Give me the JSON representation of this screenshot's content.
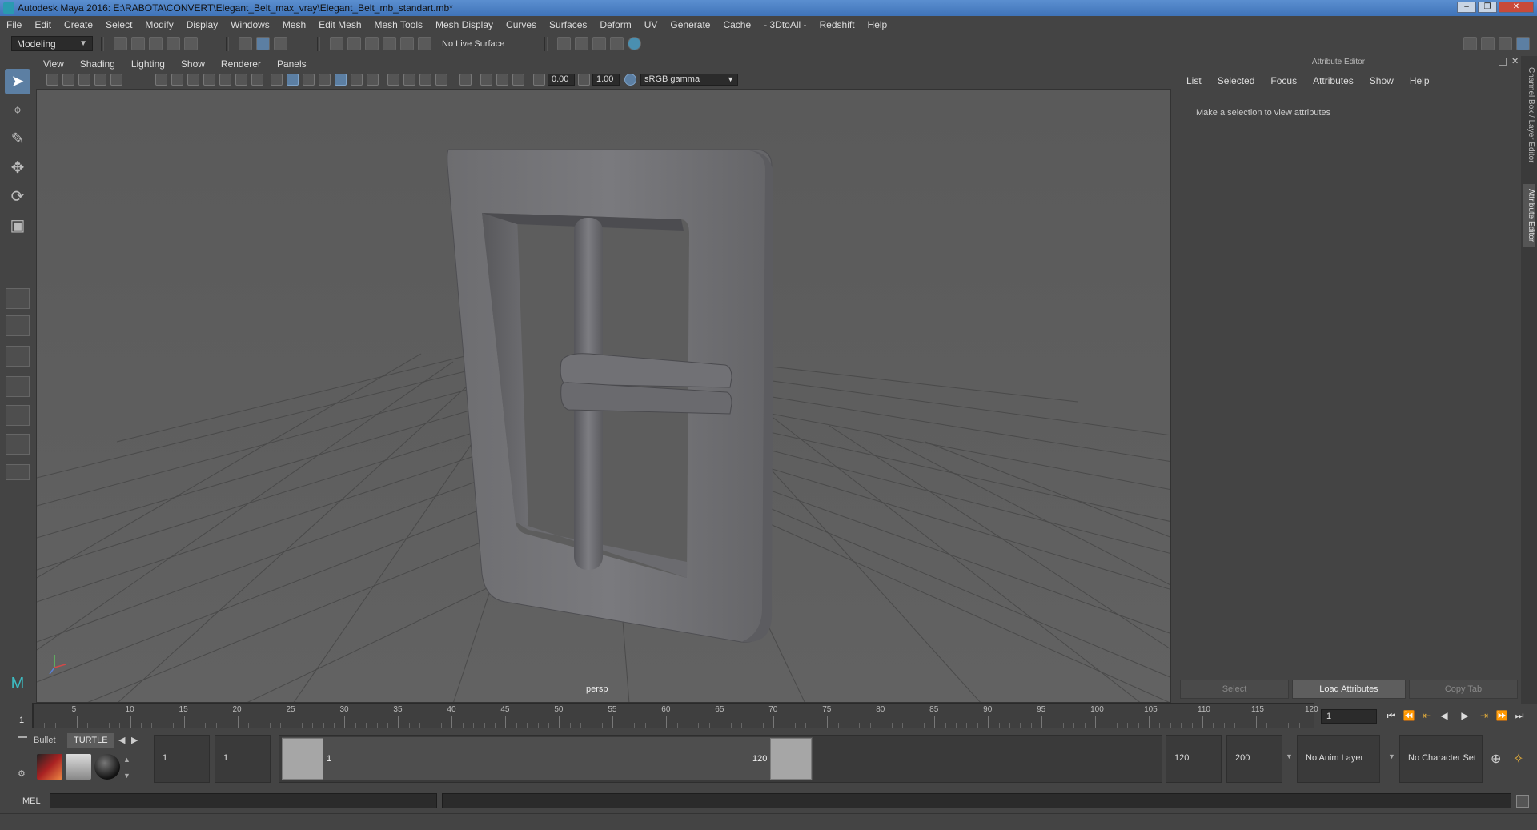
{
  "window": {
    "title": "Autodesk Maya 2016: E:\\RABOTA\\CONVERT\\Elegant_Belt_max_vray\\Elegant_Belt_mb_standart.mb*",
    "controls": [
      "–",
      "❐",
      "✕"
    ]
  },
  "menubar": [
    "File",
    "Edit",
    "Create",
    "Select",
    "Modify",
    "Display",
    "Windows",
    "Mesh",
    "Edit Mesh",
    "Mesh Tools",
    "Mesh Display",
    "Curves",
    "Surfaces",
    "Deform",
    "UV",
    "Generate",
    "Cache",
    "- 3DtoAll -",
    "Redshift",
    "Help"
  ],
  "toolbar": {
    "mode": "Modeling",
    "live_surface": "No Live Surface"
  },
  "viewport": {
    "menu": [
      "View",
      "Shading",
      "Lighting",
      "Show",
      "Renderer",
      "Panels"
    ],
    "exposure": "0.00",
    "gamma": "1.00",
    "color_space": "sRGB gamma",
    "camera_label": "persp"
  },
  "attribute_editor": {
    "title": "Attribute Editor",
    "menu": [
      "List",
      "Selected",
      "Focus",
      "Attributes",
      "Show",
      "Help"
    ],
    "message": "Make a selection to view attributes",
    "buttons": [
      "Select",
      "Load Attributes",
      "Copy Tab"
    ],
    "side_tabs": [
      "Channel Box / Layer Editor",
      "Attribute Editor"
    ]
  },
  "timeslider": {
    "current_frame": "1",
    "ticks": [
      "5",
      "10",
      "15",
      "20",
      "25",
      "30",
      "35",
      "40",
      "45",
      "50",
      "55",
      "60",
      "65",
      "70",
      "75",
      "80",
      "85",
      "90",
      "95",
      "100",
      "105",
      "110",
      "115",
      "120"
    ],
    "frame_field": "1"
  },
  "rangeslider": {
    "shelf_tabs": [
      "Bullet",
      "TURTLE"
    ],
    "start_field": "1",
    "range_start_field": "1",
    "range_start_label": "1",
    "range_end_label": "120",
    "range_end_field": "120",
    "end_field": "200",
    "anim_layer": "No Anim Layer",
    "character_set": "No Character Set"
  },
  "commandline": {
    "language": "MEL"
  }
}
